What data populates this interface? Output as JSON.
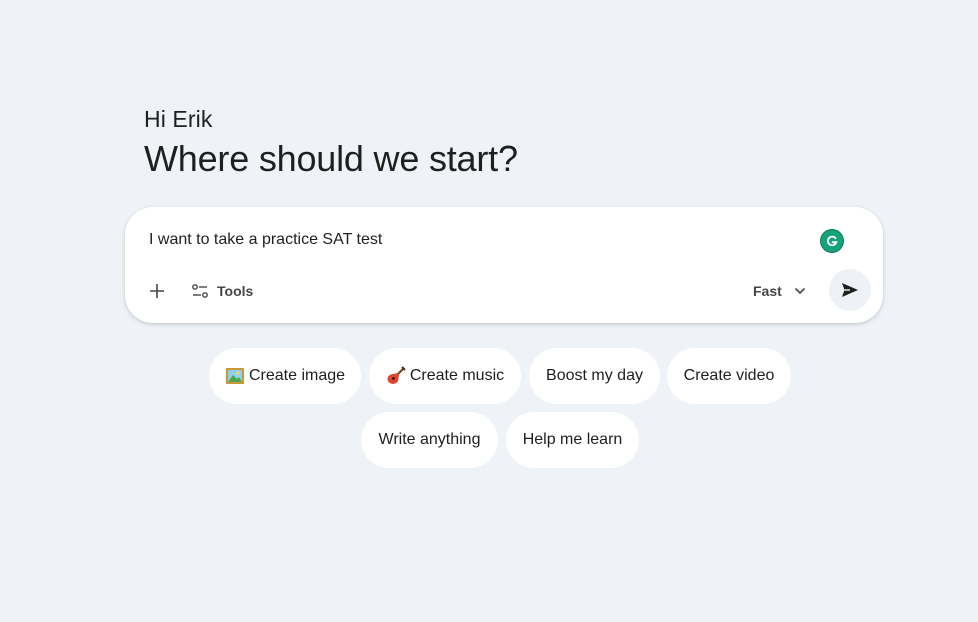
{
  "greeting": "Hi Erik",
  "headline": "Where should we start?",
  "composer": {
    "prompt_text": "I want to take a practice SAT test",
    "tools_label": "Tools",
    "mode_label": "Fast",
    "add_icon": "plus-icon",
    "tools_icon": "tools-sliders-icon",
    "mode_icon": "chevron-down-icon",
    "send_icon": "send-icon",
    "extension_icon": "grammarly-icon"
  },
  "suggestions": [
    {
      "label": "Create image",
      "icon": "picture-emoji-icon"
    },
    {
      "label": "Create music",
      "icon": "guitar-emoji-icon"
    },
    {
      "label": "Boost my day"
    },
    {
      "label": "Create video"
    },
    {
      "label": "Write anything"
    },
    {
      "label": "Help me learn"
    }
  ],
  "colors": {
    "background": "#eff3f8",
    "surface": "#ffffff",
    "text": "#1f1f1f",
    "muted": "#444746",
    "grammarly": "#15a37c"
  }
}
